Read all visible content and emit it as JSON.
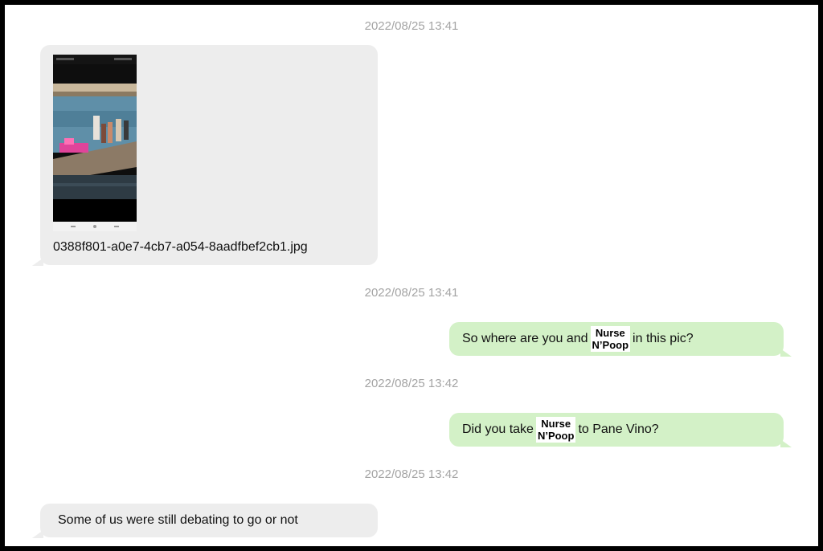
{
  "messages": [
    {
      "timestamp": "2022/08/25 13:41",
      "direction": "incoming",
      "type": "image",
      "filename": "0388f801-a0e7-4cb7-a054-8aadfbef2cb1.jpg"
    },
    {
      "timestamp": "2022/08/25 13:41",
      "direction": "outgoing",
      "text_before": "So where are you and",
      "redaction_line1": "Nurse",
      "redaction_line2": "N’Poop",
      "text_after": "in this pic?"
    },
    {
      "timestamp": "2022/08/25 13:42",
      "direction": "outgoing",
      "text_before": "Did you take",
      "redaction_line1": "Nurse",
      "redaction_line2": "N’Poop",
      "text_after": "to Pane Vino?"
    },
    {
      "timestamp": "2022/08/25 13:42",
      "direction": "incoming",
      "text": "Some of us were still debating to go or not"
    }
  ],
  "colors": {
    "incoming_bubble": "#ededed",
    "outgoing_bubble": "#d3f1c7",
    "timestamp_text": "#a4a4a4",
    "frame_border": "#000000"
  }
}
